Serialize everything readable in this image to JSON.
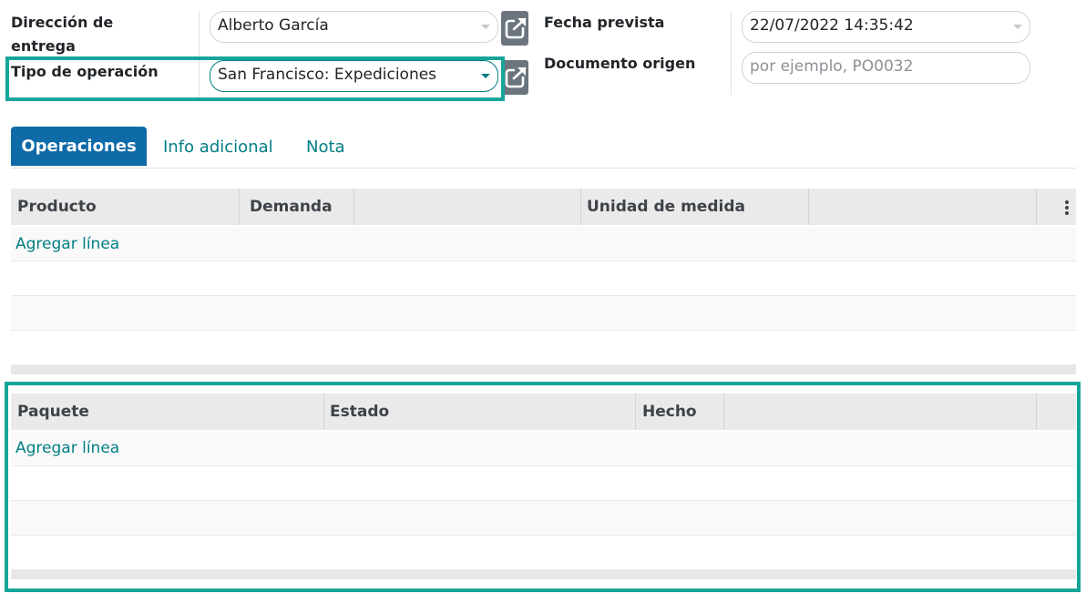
{
  "form": {
    "delivery_address": {
      "label_line1": "Dirección de",
      "label_line2": "entrega",
      "value": "Alberto García"
    },
    "operation_type": {
      "label": "Tipo de operación",
      "value": "San Francisco: Expediciones"
    },
    "scheduled_date": {
      "label": "Fecha prevista",
      "value": "22/07/2022 14:35:42"
    },
    "source_document": {
      "label": "Documento origen",
      "placeholder": "por ejemplo, PO0032"
    }
  },
  "tabs": [
    {
      "label": "Operaciones",
      "active": true
    },
    {
      "label": "Info adicional",
      "active": false
    },
    {
      "label": "Nota",
      "active": false
    }
  ],
  "operations_table": {
    "columns": [
      "Producto",
      "Demanda",
      "",
      "Unidad de medida",
      ""
    ],
    "add_line": "Agregar línea"
  },
  "packages_table": {
    "columns": [
      "Paquete",
      "Estado",
      "Hecho",
      ""
    ],
    "add_line": "Agregar línea"
  },
  "icons": {
    "external_link": "external-link-icon",
    "dropdown": "chevron-down-icon",
    "options": "kebab-menu-icon"
  },
  "colors": {
    "accent": "#017e84",
    "tab_active": "#0f6aa8",
    "highlight": "#17a59a",
    "button_gray": "#6c757d"
  }
}
